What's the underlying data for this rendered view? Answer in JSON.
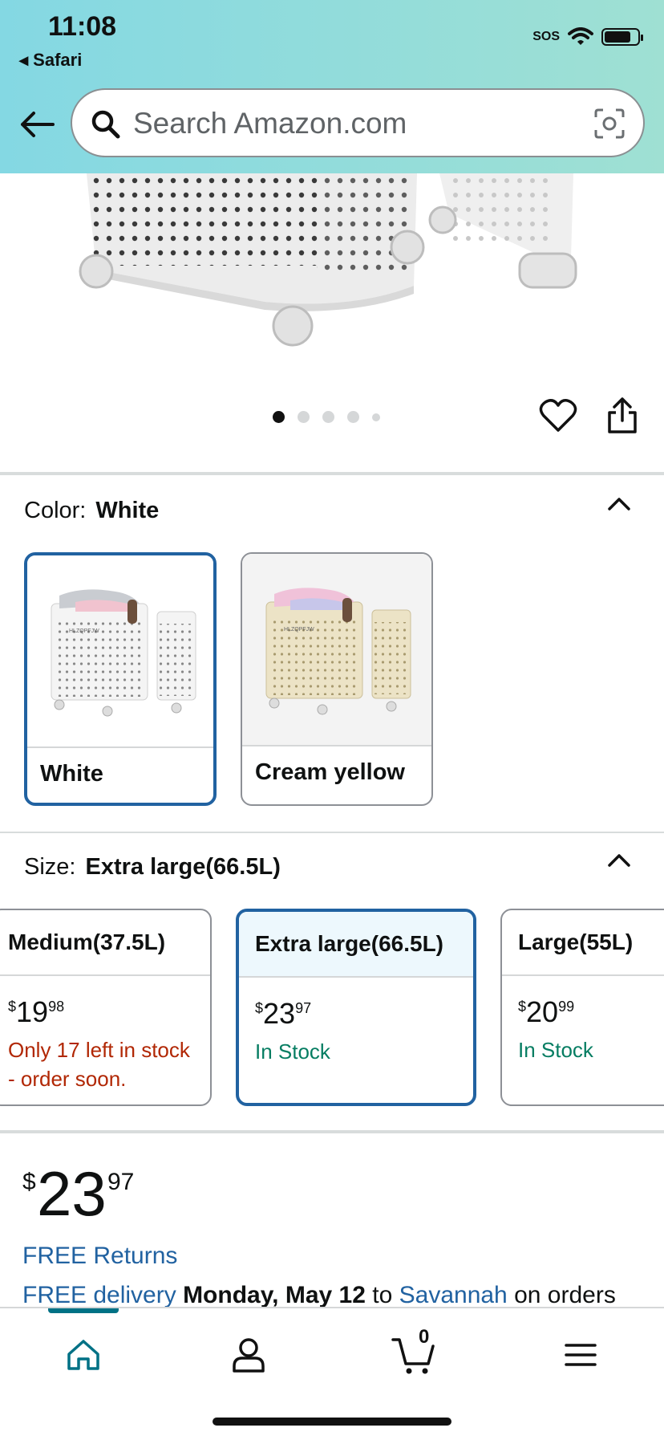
{
  "status_bar": {
    "time": "11:08",
    "back_app": "◂ Safari",
    "sos": "SOS",
    "battery_level": 0.8
  },
  "search": {
    "placeholder": "Search Amazon.com"
  },
  "gallery": {
    "image_count": 5,
    "active_index": 0
  },
  "color": {
    "label": "Color:",
    "selected": "White",
    "options": [
      {
        "name": "White"
      },
      {
        "name": "Cream yellow"
      }
    ],
    "product_print": "HLZQPFJW"
  },
  "size": {
    "label": "Size:",
    "selected": "Extra large(66.5L)",
    "options": [
      {
        "name": "Medium(37.5L)",
        "price_currency": "$",
        "price_dollars": "19",
        "price_cents": "98",
        "stock": "Only 17 left in stock - order soon."
      },
      {
        "name": "Extra large(66.5L)",
        "price_currency": "$",
        "price_dollars": "23",
        "price_cents": "97",
        "stock": "In Stock"
      },
      {
        "name": "Large(55L)",
        "price_currency": "$",
        "price_dollars": "20",
        "price_cents": "99",
        "stock": "In Stock"
      }
    ]
  },
  "price": {
    "currency": "$",
    "dollars": "23",
    "cents": "97"
  },
  "free_returns": "FREE Returns",
  "delivery": {
    "free_delivery": "FREE delivery",
    "date": "Monday, May 12",
    "to": "to",
    "city": "Savannah",
    "rest": "on orders"
  },
  "tabbar": {
    "cart_count": "0"
  },
  "colors": {
    "accent": "#2162a1",
    "header_start": "#84d8e3",
    "header_end": "#9fe0d3",
    "in_stock": "#067d62",
    "low_stock": "#b12704",
    "tab_active": "#007185"
  }
}
